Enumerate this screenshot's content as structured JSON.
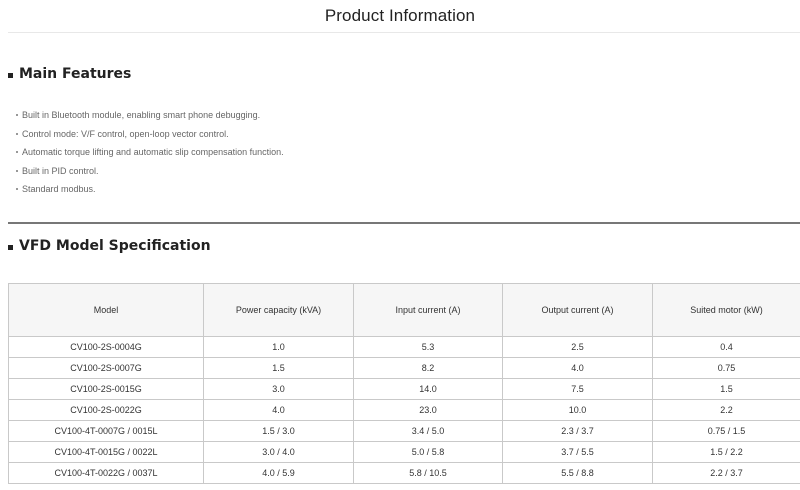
{
  "page": {
    "title": "Product Information"
  },
  "main_features": {
    "heading": "Main Features",
    "items": [
      "Built in Bluetooth module, enabling smart phone debugging.",
      "Control mode: V/F control, open-loop vector control.",
      "Automatic torque lifting and automatic slip compensation function.",
      "Built in PID control.",
      "Standard modbus."
    ]
  },
  "spec": {
    "heading": "VFD Model Specification",
    "columns": [
      "Model",
      "Power capacity (kVA)",
      "Input current (A)",
      "Output current (A)",
      "Suited motor (kW)"
    ],
    "rows": [
      [
        "CV100-2S-0004G",
        "1.0",
        "5.3",
        "2.5",
        "0.4"
      ],
      [
        "CV100-2S-0007G",
        "1.5",
        "8.2",
        "4.0",
        "0.75"
      ],
      [
        "CV100-2S-0015G",
        "3.0",
        "14.0",
        "7.5",
        "1.5"
      ],
      [
        "CV100-2S-0022G",
        "4.0",
        "23.0",
        "10.0",
        "2.2"
      ],
      [
        "CV100-4T-0007G / 0015L",
        "1.5 / 3.0",
        "3.4 / 5.0",
        "2.3 / 3.7",
        "0.75 / 1.5"
      ],
      [
        "CV100-4T-0015G / 0022L",
        "3.0 / 4.0",
        "5.0 / 5.8",
        "3.7 / 5.5",
        "1.5 / 2.2"
      ],
      [
        "CV100-4T-0022G / 0037L",
        "4.0 / 5.9",
        "5.8 / 10.5",
        "5.5 / 8.8",
        "2.2 / 3.7"
      ]
    ]
  }
}
